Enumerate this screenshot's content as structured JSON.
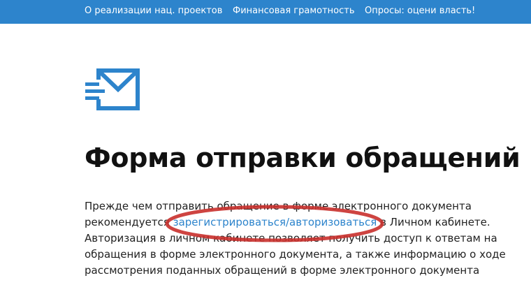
{
  "nav": {
    "links": [
      {
        "label": "О реализации нац. проектов"
      },
      {
        "label": "Финансовая грамотность"
      },
      {
        "label": "Опросы: оцени власть!"
      }
    ]
  },
  "icon": "mail-send-icon",
  "page_title": "Форма отправки обращений",
  "intro": {
    "line1": "Прежде чем отправить обращение в форме электронного документа",
    "line2_prefix": "рекомендуется",
    "line2_link": "зарегистрироваться/авторизоваться",
    "line2_suffix": "в Личном кабинете.",
    "line3": "Авторизация в личном кабинете позволяет получить доступ к ответам на",
    "line4": "обращения в форме электронного документа, а также информацию о ходе",
    "line5": "рассмотрения поданных обращений в форме электронного документа"
  },
  "colors": {
    "nav_bg": "#2d84cc",
    "link": "#2d84cc",
    "icon": "#2d84cc",
    "highlight_ellipse": "#c9302c"
  }
}
